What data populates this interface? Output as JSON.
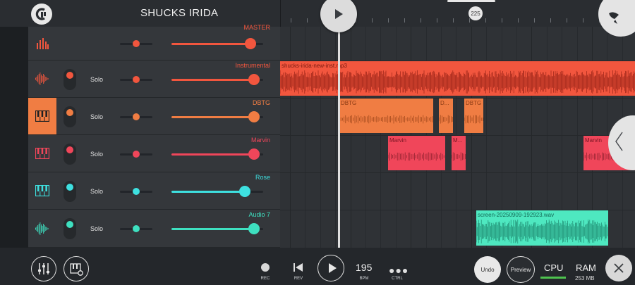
{
  "app": {
    "project_title": "SHUCKS IRIDA"
  },
  "ruler": {
    "tempo_marker": "225"
  },
  "tracks": [
    {
      "name": "MASTER",
      "color": "#f2563e",
      "icon": "level-bars-icon",
      "solo": "",
      "pan": 0.5,
      "volume": 0.86
    },
    {
      "name": "Instrumental",
      "color": "#f2563e",
      "icon": "waveform-icon",
      "solo": "Solo",
      "pan": 0.5,
      "volume": 0.9
    },
    {
      "name": "DBTG",
      "color": "#f07d43",
      "icon": "piano-icon",
      "solo": "Solo",
      "pan": 0.5,
      "volume": 0.9
    },
    {
      "name": "Marvin",
      "color": "#f0465a",
      "icon": "piano-icon",
      "solo": "Solo",
      "pan": 0.5,
      "volume": 0.9
    },
    {
      "name": "Rose",
      "color": "#3ee0e0",
      "icon": "piano-icon",
      "solo": "Solo",
      "pan": 0.5,
      "volume": 0.8
    },
    {
      "name": "Audio 7",
      "color": "#3ee0c0",
      "icon": "waveform-icon",
      "solo": "Solo",
      "pan": 0.5,
      "volume": 0.9
    }
  ],
  "clips": {
    "instrumental": "shucks-irida-new-inst.mp3",
    "dbtg_1": "DBTG",
    "dbtg_2": "D...",
    "dbtg_3": "DBTG",
    "marvin_1": "Marvin",
    "marvin_2": "M...",
    "marvin_3": "Marvin",
    "audio7": "screen-20250909-192923.wav"
  },
  "bottombar": {
    "rec": "REC",
    "rev": "REV",
    "bpm_value": "195",
    "bpm_label": "BPM",
    "ctrl": "CTRL",
    "undo": "Undo",
    "preview": "Preview",
    "cpu": "CPU",
    "ram": "RAM",
    "ram_value": "253 MB"
  },
  "colors": {
    "instrumental": "#f2563e",
    "dbtg": "#f07d43",
    "marvin": "#f0465a",
    "audio7": "#4ee8c0",
    "selected_track": "#f07d43"
  }
}
